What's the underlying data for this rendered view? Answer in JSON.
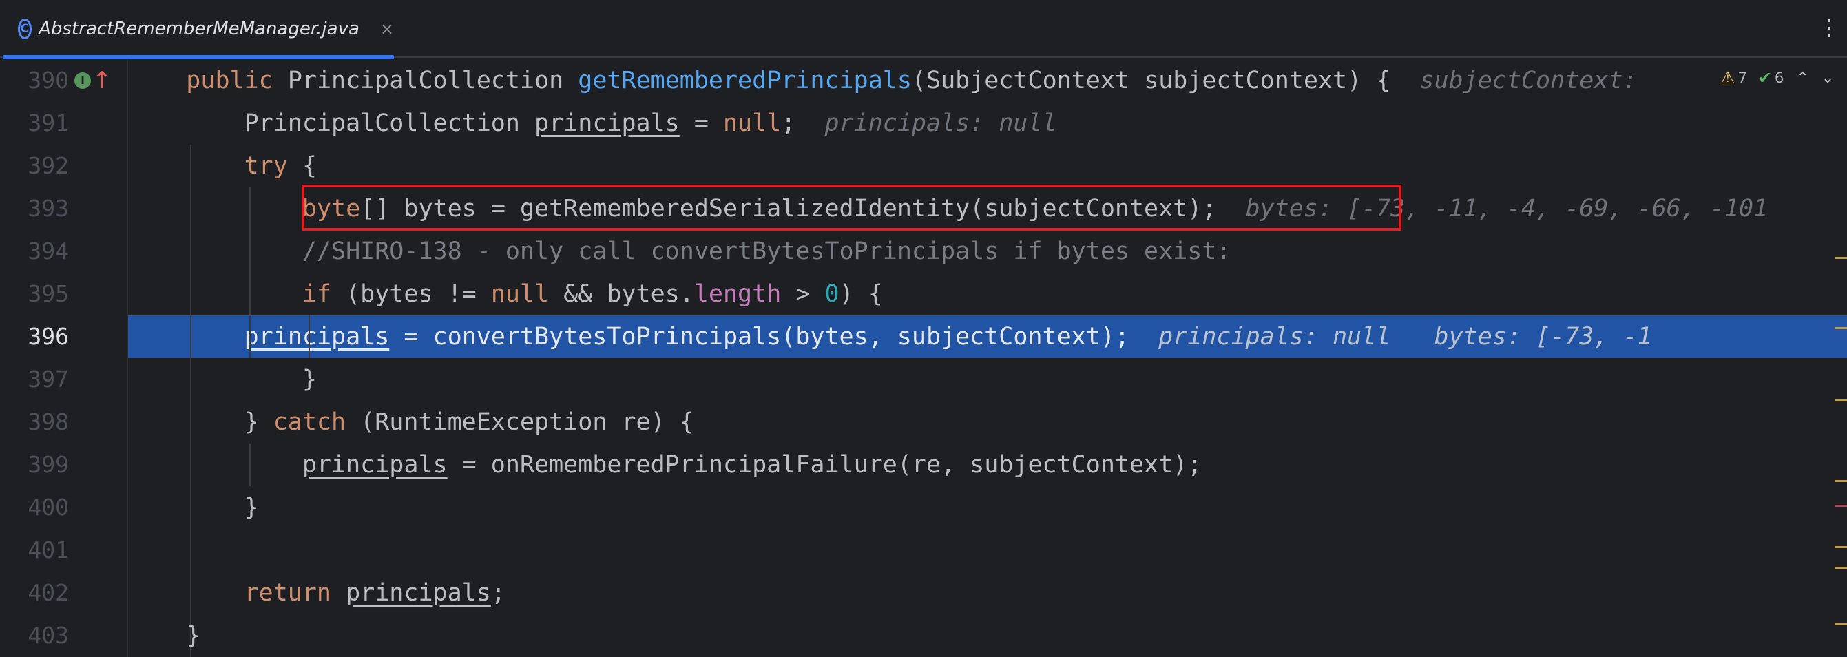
{
  "tab": {
    "title": "AbstractRememberMeManager.java",
    "icon_letter": "C",
    "close_glyph": "×"
  },
  "menu_glyph": "⋮",
  "inspection": {
    "warnings": "7",
    "weak_warnings": "6",
    "up_glyph": "⌃",
    "down_glyph": "⌄"
  },
  "gutter": {
    "impl_glyph": "I",
    "override_glyph": "↑",
    "line_numbers": [
      "390",
      "391",
      "392",
      "393",
      "394",
      "395",
      "396",
      "397",
      "398",
      "399",
      "400",
      "401",
      "402",
      "403"
    ]
  },
  "code": {
    "l390": {
      "kw": "public",
      "type": "PrincipalCollection",
      "fn": "getRememberedPrincipals",
      "rest": "(SubjectContext subjectContext) {",
      "hint": "subjectContext:"
    },
    "l391": {
      "type": "PrincipalCollection",
      "var": "principals",
      "eq": " = ",
      "kw": "null",
      "semi": ";",
      "hint": "principals: null"
    },
    "l392": {
      "kw": "try",
      "rest": " {"
    },
    "l393": {
      "kw": "byte",
      "rest": "[] bytes = getRememberedSerializedIdentity(subjectContext);",
      "hint": "bytes: [-73, -11, -4, -69, -66, -101"
    },
    "l394": {
      "cmt": "//SHIRO-138 - only call convertBytesToPrincipals if bytes exist:"
    },
    "l395": {
      "kw1": "if",
      "p1": " (bytes != ",
      "kw2": "null",
      "p2": " && bytes.",
      "field": "length",
      "p3": " > ",
      "num": "0",
      "p4": ") {"
    },
    "l396": {
      "var": "principals",
      "rest": " = convertBytesToPrincipals(bytes, subjectContext);",
      "hint1": "principals: null",
      "hint2": "bytes: [-73, -1"
    },
    "l397": {
      "rest": "}"
    },
    "l398": {
      "p1": "} ",
      "kw": "catch",
      "rest": " (RuntimeException re) {"
    },
    "l399": {
      "var": "principals",
      "rest": " = onRememberedPrincipalFailure(re, subjectContext);"
    },
    "l400": {
      "rest": "}"
    },
    "l401": {
      "rest": ""
    },
    "l402": {
      "kw": "return",
      "var": "principals",
      "semi": ";"
    },
    "l403": {
      "rest": "}"
    }
  },
  "colors": {
    "background": "#1e1f22",
    "execution_line": "#2154a5",
    "highlight_box": "#e11d21",
    "keyword": "#cf8e6d",
    "method": "#56a8f5",
    "number": "#2aacb8",
    "field": "#c77dbb",
    "comment": "#7a7e85",
    "accent": "#3574f0"
  }
}
